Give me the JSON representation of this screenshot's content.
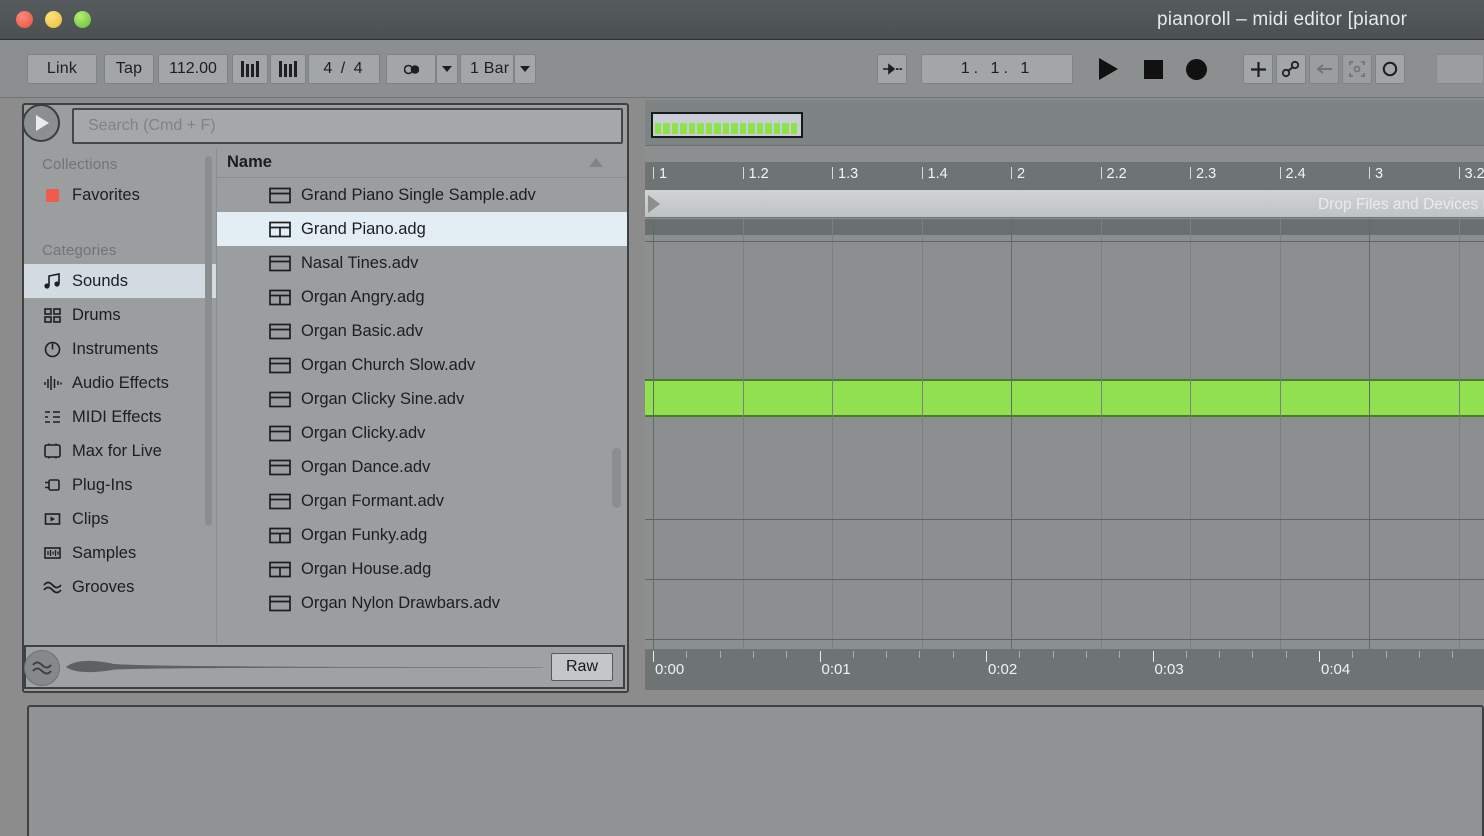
{
  "window": {
    "title": "pianoroll – midi editor  [pianor",
    "traffic_lights": [
      "close-red",
      "minimize-yellow",
      "zoom-green"
    ]
  },
  "toolbar": {
    "link_label": "Link",
    "tap_label": "Tap",
    "tempo_value": "112.00",
    "metronome_icon": "metronome-bars-icon",
    "metronome_alt_icon": "metronome-bars-icon",
    "time_signature": "4 / 4",
    "follow_icon": "circle-dot-icon",
    "quantize_value": "1 Bar",
    "punch_icon": "arrow-punch-icon",
    "position_value": "1.  1.  1",
    "play_icon": "play-icon",
    "stop_icon": "stop-icon",
    "record_icon": "record-icon",
    "draw_icon": "plus-icon",
    "automation_icon": "automation-link-icon",
    "back_icon": "arrow-left-icon",
    "loop_icon": "loop-brackets-icon",
    "key_icon": "circle-icon"
  },
  "browser": {
    "preview_play_icon": "play-circle-icon",
    "search": {
      "placeholder": "Search (Cmd + F)",
      "value": ""
    },
    "collections_header": "Collections",
    "collections": [
      {
        "label": "Favorites",
        "icon": "red-square-icon",
        "color": "#ef5b4c"
      }
    ],
    "categories_header": "Categories",
    "categories": [
      {
        "label": "Sounds",
        "icon": "music-note-icon",
        "selected": true
      },
      {
        "label": "Drums",
        "icon": "drum-pads-icon",
        "selected": false
      },
      {
        "label": "Instruments",
        "icon": "instrument-dial-icon",
        "selected": false
      },
      {
        "label": "Audio Effects",
        "icon": "audio-waveform-icon",
        "selected": false
      },
      {
        "label": "MIDI Effects",
        "icon": "midi-list-icon",
        "selected": false
      },
      {
        "label": "Max for Live",
        "icon": "max-for-live-icon",
        "selected": false
      },
      {
        "label": "Plug-Ins",
        "icon": "plugin-icon",
        "selected": false
      },
      {
        "label": "Clips",
        "icon": "clip-icon",
        "selected": false
      },
      {
        "label": "Samples",
        "icon": "sample-icon",
        "selected": false
      },
      {
        "label": "Grooves",
        "icon": "groove-wave-icon",
        "selected": false
      }
    ],
    "list": {
      "column_header": "Name",
      "sort_icon": "sort-ascending-icon",
      "rows": [
        {
          "name": "Grand Piano Single Sample.adv",
          "icon": "preset-adv-icon",
          "selected": false
        },
        {
          "name": "Grand Piano.adg",
          "icon": "rack-adg-icon",
          "selected": true
        },
        {
          "name": "Nasal Tines.adv",
          "icon": "preset-adv-icon",
          "selected": false
        },
        {
          "name": "Organ Angry.adg",
          "icon": "rack-adg-icon",
          "selected": false
        },
        {
          "name": "Organ Basic.adv",
          "icon": "preset-adv-icon",
          "selected": false
        },
        {
          "name": "Organ Church Slow.adv",
          "icon": "preset-adv-icon",
          "selected": false
        },
        {
          "name": "Organ Clicky Sine.adv",
          "icon": "preset-adv-icon",
          "selected": false
        },
        {
          "name": "Organ Clicky.adv",
          "icon": "preset-adv-icon",
          "selected": false
        },
        {
          "name": "Organ Dance.adv",
          "icon": "preset-adv-icon",
          "selected": false
        },
        {
          "name": "Organ Formant.adv",
          "icon": "preset-adv-icon",
          "selected": false
        },
        {
          "name": "Organ Funky.adg",
          "icon": "rack-adg-icon",
          "selected": false
        },
        {
          "name": "Organ House.adg",
          "icon": "rack-adg-icon",
          "selected": false
        },
        {
          "name": "Organ Nylon Drawbars.adv",
          "icon": "preset-adv-icon",
          "selected": false
        }
      ]
    },
    "preview": {
      "headphone_icon": "headphone-icon",
      "raw_label": "Raw",
      "waveform_toggle_icon": "waveform-toggle-icon"
    }
  },
  "arrangement": {
    "overview_clip_note_count": 17,
    "bar_ticks": [
      "1",
      "1.2",
      "1.3",
      "1.4",
      "2",
      "2.2",
      "2.3",
      "2.4",
      "3",
      "3.2"
    ],
    "time_ticks": [
      "0:00",
      "0:01",
      "0:02",
      "0:03",
      "0:04"
    ],
    "drop_hint": "Drop Files and Devices Here",
    "clip_color": "#90e050"
  }
}
